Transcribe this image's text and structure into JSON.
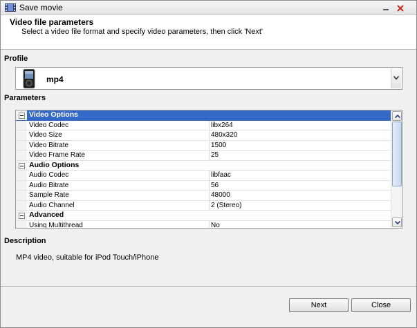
{
  "window": {
    "title": "Save movie"
  },
  "header": {
    "title": "Video file parameters",
    "subtitle": "Select a video file format and specify video parameters, then click 'Next'"
  },
  "profile": {
    "label": "Profile",
    "value": "mp4",
    "icon": "ipod-icon"
  },
  "parameters": {
    "label": "Parameters",
    "rows": [
      {
        "type": "category",
        "name": "Video Options",
        "selected": true
      },
      {
        "type": "item",
        "name": "Video Codec",
        "value": "libx264"
      },
      {
        "type": "item",
        "name": "Video Size",
        "value": "480x320"
      },
      {
        "type": "item",
        "name": "Video Bitrate",
        "value": "1500"
      },
      {
        "type": "item",
        "name": "Video Frame Rate",
        "value": "25"
      },
      {
        "type": "category",
        "name": "Audio Options"
      },
      {
        "type": "item",
        "name": "Audio Codec",
        "value": "libfaac"
      },
      {
        "type": "item",
        "name": "Audio Bitrate",
        "value": "56"
      },
      {
        "type": "item",
        "name": "Sample Rate",
        "value": "48000"
      },
      {
        "type": "item",
        "name": "Audio Channel",
        "value": "2 (Stereo)"
      },
      {
        "type": "category",
        "name": "Advanced"
      },
      {
        "type": "item",
        "name": "Using Multithread",
        "value": "No"
      }
    ]
  },
  "description": {
    "label": "Description",
    "text": "MP4 video, suitable for iPod Touch/iPhone"
  },
  "buttons": {
    "next": "Next",
    "close": "Close"
  },
  "colors": {
    "selection": "#3569c8",
    "close_x": "#c42b1c"
  }
}
